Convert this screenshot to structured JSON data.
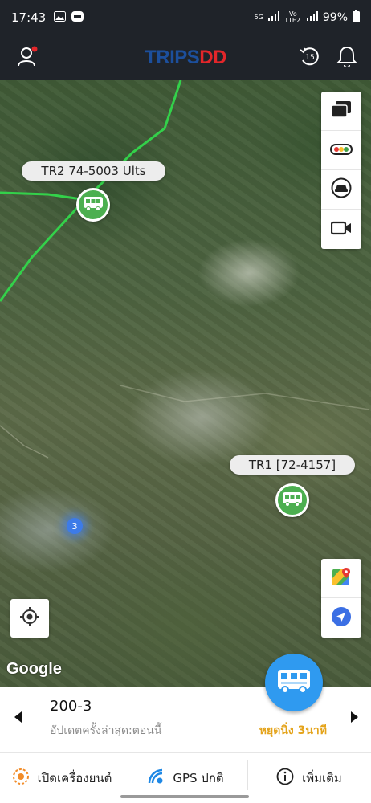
{
  "status_bar": {
    "time": "17:43",
    "network_top": "5G",
    "network_bottom": "Vo LTE2",
    "battery": "99%"
  },
  "app_bar": {
    "logo_part1": "TRIPS",
    "logo_part2": "DD",
    "history_badge": "15"
  },
  "map": {
    "vehicles": [
      {
        "label": "TR2 74-5003 Ults"
      },
      {
        "label": "TR1 [72-4157]"
      }
    ],
    "cluster_count": "3",
    "attribution": "Google"
  },
  "info_panel": {
    "route": "200-3",
    "last_update": "อัปเดตครั้งล่าสุด:ตอนนี้",
    "stop_status": "หยุดนิ่ง 3นาที"
  },
  "actions": [
    {
      "label": "เปิดเครื่องยนต์",
      "icon": "engine-icon"
    },
    {
      "label": "GPS ปกติ",
      "icon": "gps-signal-icon"
    },
    {
      "label": "เพิ่มเติม",
      "icon": "info-icon"
    }
  ],
  "colors": {
    "header_bg": "#1f2329",
    "bus_marker": "#4caf50",
    "fab": "#2f9af0",
    "status_warning": "#e4a31a",
    "route_line": "#33d14a"
  }
}
